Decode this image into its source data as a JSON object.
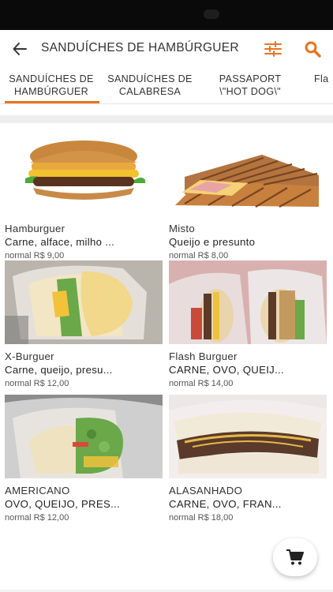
{
  "header": {
    "title": "SANDUÍCHES DE HAMBÚRGUER",
    "back_icon": "arrow-left-icon",
    "filter_icon": "sliders-icon",
    "search_icon": "search-icon",
    "accent_color": "#e8731e"
  },
  "tabs": [
    {
      "label": "SANDUÍCHES DE\nHAMBÚRGUER",
      "active": true
    },
    {
      "label": "SANDUÍCHES DE\nCALABRESA",
      "active": false
    },
    {
      "label": "PASSAPORT\n\\\"HOT DOG\\\"",
      "active": false
    },
    {
      "label": "Fla",
      "active": false
    }
  ],
  "products": [
    {
      "name": "Hamburguer",
      "desc": "Carne, alface, milho ...",
      "price": "normal R$ 9,00"
    },
    {
      "name": "Misto",
      "desc": "Queijo e presunto",
      "price": "normal R$ 8,00"
    },
    {
      "name": "X-Burguer",
      "desc": "Carne, queijo, presu...",
      "price": "normal R$ 12,00"
    },
    {
      "name": "Flash Burguer",
      "desc": "CARNE, OVO, QUEIJ...",
      "price": "normal R$ 14,00"
    },
    {
      "name": "AMERICANO",
      "desc": "OVO, QUEIJO, PRES...",
      "price": "normal R$ 12,00"
    },
    {
      "name": "ALASANHADO",
      "desc": "CARNE, OVO, FRAN...",
      "price": "normal R$ 18,00"
    }
  ],
  "cart": {
    "icon": "shopping-cart-icon"
  }
}
